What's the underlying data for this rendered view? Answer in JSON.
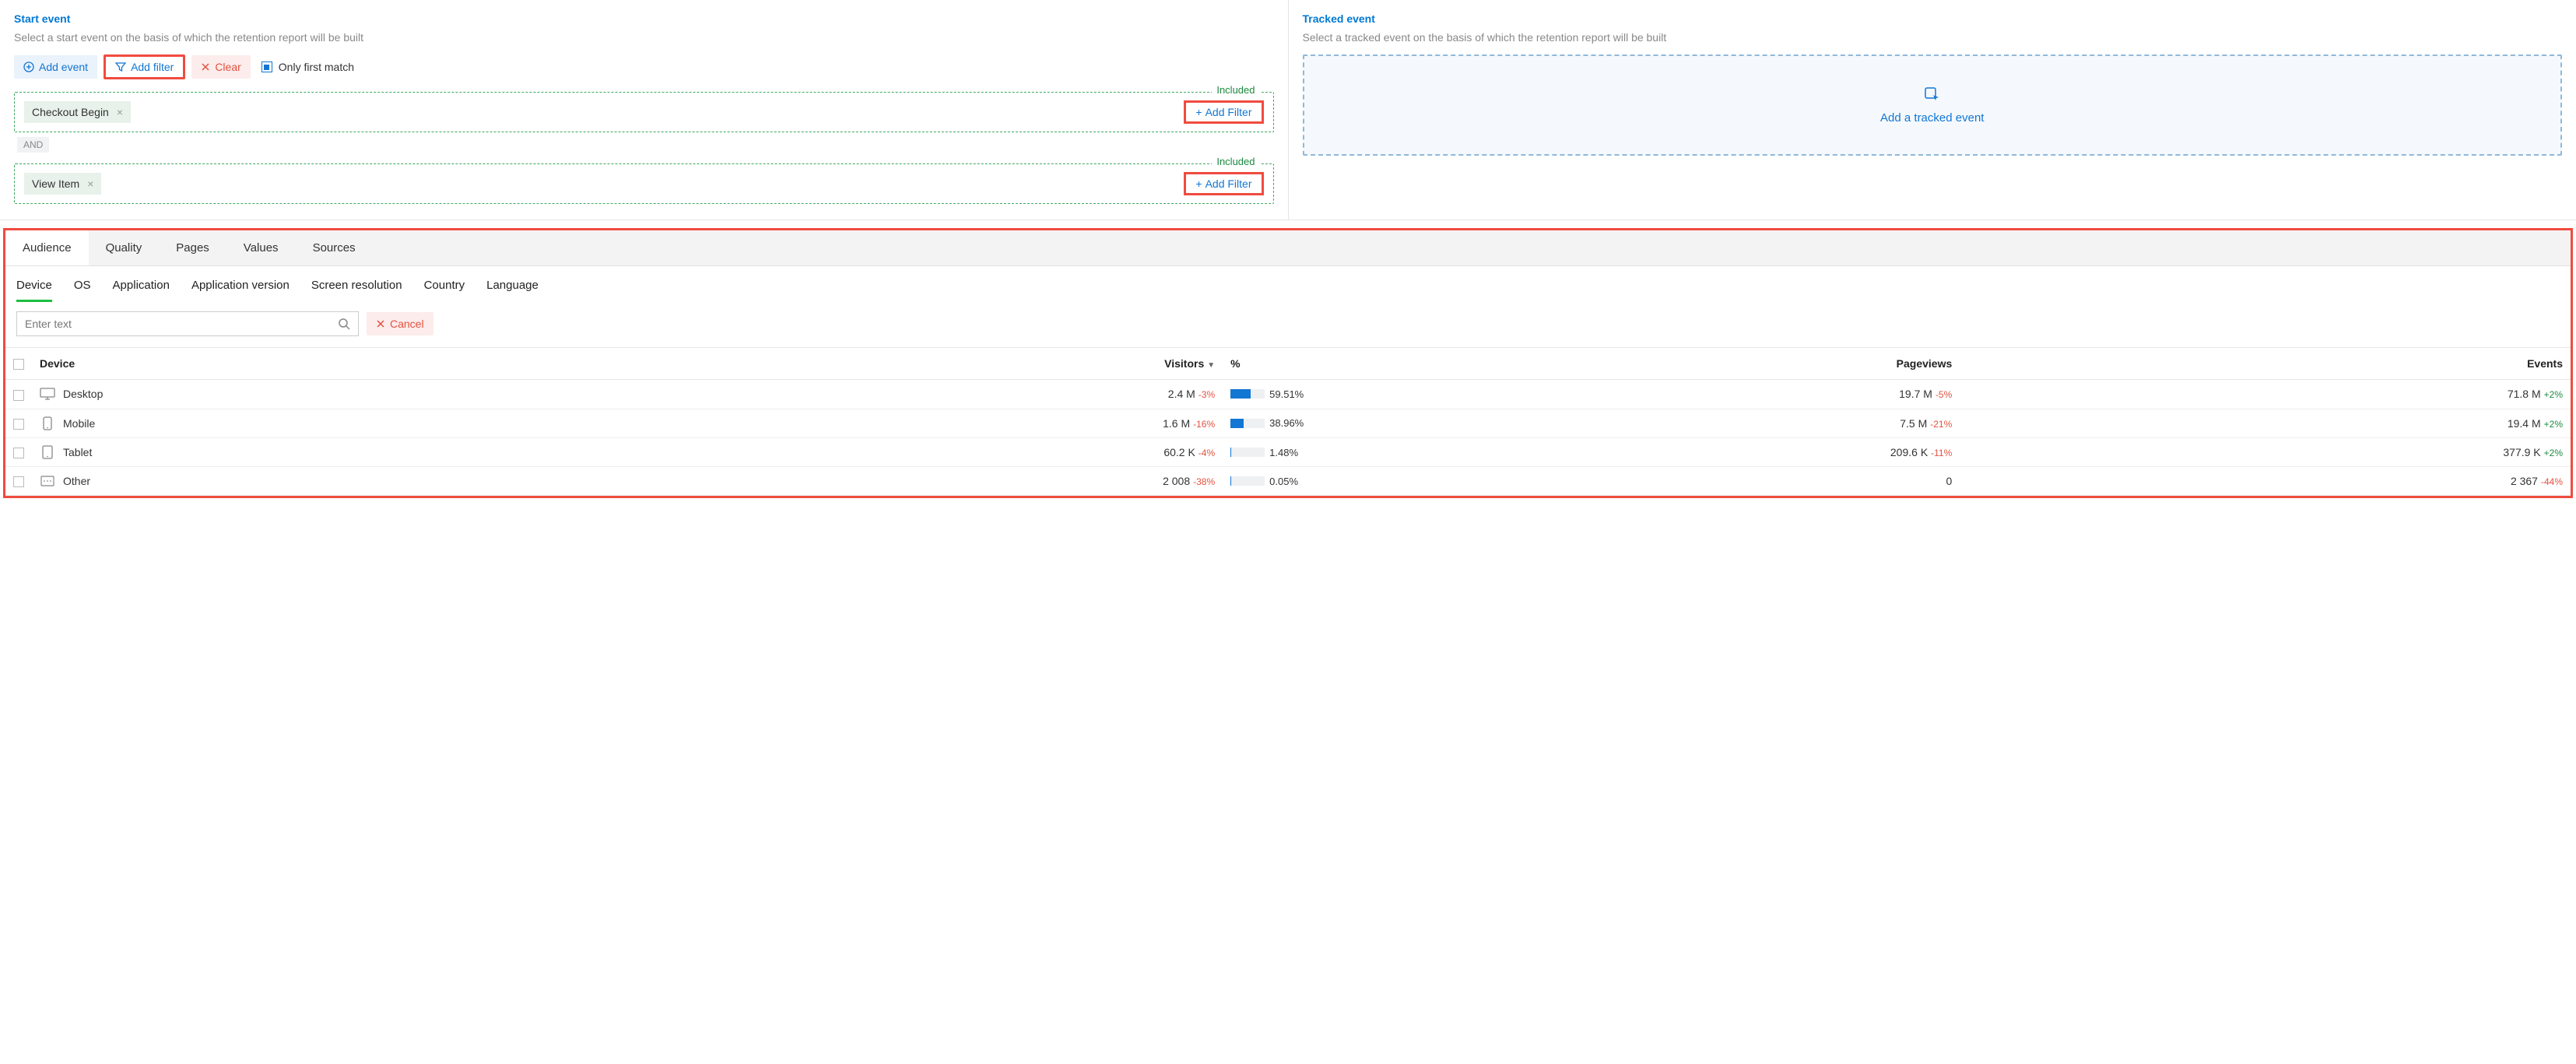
{
  "start_event": {
    "title": "Start event",
    "desc": "Select a start event on the basis of which the retention report will be built",
    "add_event": "Add event",
    "add_filter": "Add filter",
    "clear": "Clear",
    "only_first_match": "Only first match",
    "included": "Included",
    "add_filter_inner": "Add Filter",
    "and": "AND",
    "events": [
      {
        "name": "Checkout Begin"
      },
      {
        "name": "View Item"
      }
    ]
  },
  "tracked_event": {
    "title": "Tracked event",
    "desc": "Select a tracked event on the basis of which the retention report will be built",
    "add_label": "Add a tracked event"
  },
  "filter_panel": {
    "main_tabs": [
      "Audience",
      "Quality",
      "Pages",
      "Values",
      "Sources"
    ],
    "active_main": "Audience",
    "sub_tabs": [
      "Device",
      "OS",
      "Application",
      "Application version",
      "Screen resolution",
      "Country",
      "Language"
    ],
    "active_sub": "Device",
    "search_placeholder": "Enter text",
    "cancel": "Cancel",
    "columns": {
      "device": "Device",
      "visitors": "Visitors",
      "percent": "%",
      "pageviews": "Pageviews",
      "events": "Events"
    },
    "rows": [
      {
        "icon": "desktop",
        "device": "Desktop",
        "visitors": "2.4 M",
        "visitors_delta": "-3%",
        "pct": "59.51%",
        "pct_bar": 59.51,
        "pageviews": "19.7 M",
        "pageviews_delta": "-5%",
        "events": "71.8 M",
        "events_delta": "+2%",
        "events_delta_sign": "pos"
      },
      {
        "icon": "mobile",
        "device": "Mobile",
        "visitors": "1.6 M",
        "visitors_delta": "-16%",
        "pct": "38.96%",
        "pct_bar": 38.96,
        "pageviews": "7.5 M",
        "pageviews_delta": "-21%",
        "events": "19.4 M",
        "events_delta": "+2%",
        "events_delta_sign": "pos"
      },
      {
        "icon": "tablet",
        "device": "Tablet",
        "visitors": "60.2 K",
        "visitors_delta": "-4%",
        "pct": "1.48%",
        "pct_bar": 1.48,
        "pageviews": "209.6 K",
        "pageviews_delta": "-11%",
        "events": "377.9 K",
        "events_delta": "+2%",
        "events_delta_sign": "pos"
      },
      {
        "icon": "other",
        "device": "Other",
        "visitors": "2 008",
        "visitors_delta": "-38%",
        "pct": "0.05%",
        "pct_bar": 0.05,
        "pageviews": "0",
        "pageviews_delta": "",
        "events": "2 367",
        "events_delta": "-44%",
        "events_delta_sign": "neg"
      }
    ]
  }
}
